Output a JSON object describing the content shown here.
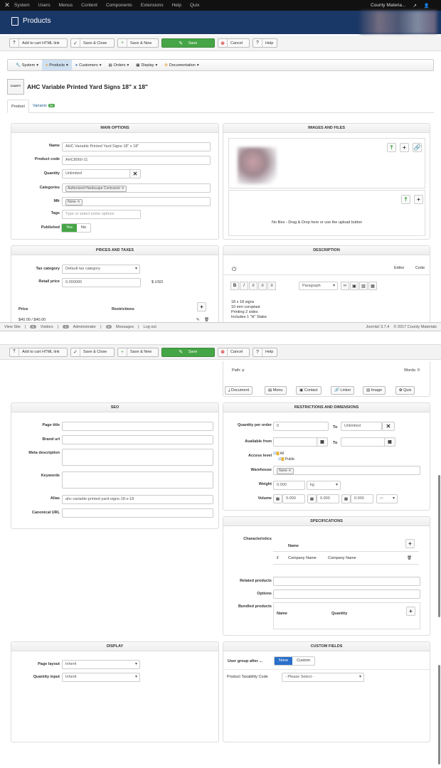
{
  "topbar": {
    "menu": [
      "System",
      "Users",
      "Menus",
      "Content",
      "Components",
      "Extensions",
      "Help",
      "Quix"
    ],
    "site_name": "County Materia..."
  },
  "header": {
    "title": "Products"
  },
  "toolbar": {
    "add_to_cart": "Add to cart HTML link",
    "save_close": "Save & Close",
    "save_new": "Save & New",
    "save": "Save",
    "cancel": "Cancel",
    "help": "Help"
  },
  "navbar": {
    "items": [
      "System",
      "Products",
      "Customers",
      "Orders",
      "Display",
      "Documentation"
    ]
  },
  "product": {
    "thumb_brand": "COUNTY",
    "title": "AHC Variable Printed Yard Signs 18\" x 18\""
  },
  "tabs": {
    "product": "Product",
    "variants": "Variants",
    "variants_count": "30"
  },
  "main_options": {
    "heading": "MAIN OPTIONS",
    "name_label": "Name",
    "name_value": "AHC Variable Printed Yard Signs 18\" x 18\"",
    "code_label": "Product code",
    "code_value": "AHC8060-11",
    "quantity_label": "Quantity",
    "quantity_value": "Unlimited",
    "categories_label": "Categories",
    "categories_tag": "Authorized Hardscape Contractor",
    "mfr_label": "Mfr",
    "mfr_tag": "None",
    "tags_label": "Tags",
    "tags_placeholder": "Type or select some options",
    "published_label": "Published",
    "published_yes": "Yes",
    "published_no": "No"
  },
  "images": {
    "heading": "IMAGES AND FILES",
    "dropzone_text": "No files - Drag & Drop here or use the upload button"
  },
  "prices": {
    "heading": "PRICES AND TAXES",
    "tax_label": "Tax category",
    "tax_value": "Default tax category",
    "retail_label": "Retail price",
    "retail_value": "0.000000",
    "currency": "$ USD",
    "col_price": "Price",
    "col_restrictions": "Restrictions",
    "row_price": "$40.00 / $40.00"
  },
  "description": {
    "heading": "DESCRIPTION",
    "editor_tab": "Editor",
    "code_tab": "Code",
    "format": "Paragraph",
    "lines": [
      "18 x 18 signs",
      "10 mm coroplast",
      "Printing 2 sides",
      "Includes 1 \"H\" Stake"
    ],
    "path": "Path: p",
    "words": "Words: 0",
    "buttons": [
      "Document",
      "Menu",
      "Contact",
      "Linker",
      "Image",
      "Quix"
    ]
  },
  "statusbar": {
    "view_site": "View Site",
    "visitors_count": "0",
    "visitors": "Visitors",
    "admin_count": "1",
    "admin": "Administrator",
    "messages_count": "0",
    "messages": "Messages",
    "logout": "Log out",
    "version": "Joomla! 3.7.4",
    "copyright": "© 2017 County Materials"
  },
  "seo": {
    "heading": "SEO",
    "page_title": "Page title",
    "brand_url": "Brand url",
    "meta_description": "Meta description",
    "keywords": "Keywords",
    "alias_label": "Alias",
    "alias_value": "ahc-variable-printed-yard-signs-18-x-18",
    "canonical": "Canonical URL"
  },
  "restrictions": {
    "heading": "RESTRICTIONS AND DIMENSIONS",
    "qty_label": "Quantity per order",
    "qty_from": "0",
    "to": "To",
    "qty_to": "Unlimited",
    "avail_label": "Available from",
    "access_label": "Access level",
    "access_all": "All",
    "access_public": "Public",
    "warehouse_label": "Warehouse",
    "warehouse_tag": "None",
    "weight_label": "Weight",
    "weight_value": "0.000",
    "weight_unit": "kg",
    "volume_label": "Volume",
    "vol_a": "0.000",
    "vol_b": "0.000",
    "vol_c": "0.000",
    "vol_unit": "m"
  },
  "specifications": {
    "heading": "SPECIFICATIONS",
    "characteristics": "Characteristics",
    "name_col": "Name",
    "row_name": "Company Name",
    "row_value": "Company Name",
    "related": "Related products",
    "options": "Options",
    "bundled": "Bundled products",
    "b_name": "Name",
    "b_qty": "Quantity"
  },
  "display": {
    "heading": "DISPLAY",
    "layout_label": "Page layout",
    "layout_value": "Inherit",
    "qty_input_label": "Quantity input",
    "qty_input_value": "Inherit"
  },
  "custom_fields": {
    "heading": "CUSTOM FIELDS",
    "group_label": "User group after ...",
    "none": "None",
    "custom": "Custom",
    "taxability_label": "Product Taxability Code",
    "taxability_value": "- Please Select -"
  }
}
